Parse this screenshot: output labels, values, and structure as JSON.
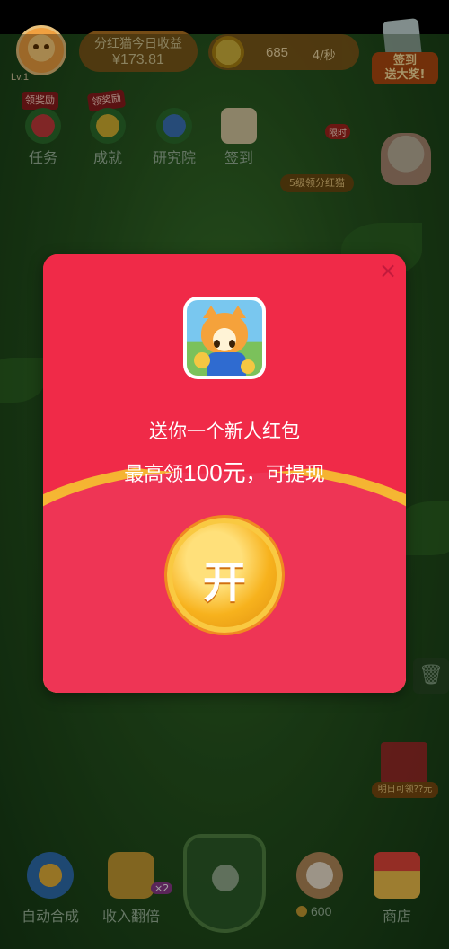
{
  "header": {
    "level": "Lv.1",
    "earnings_title": "分红猫今日收益",
    "earnings_value": "¥173.81",
    "coins": "685",
    "coin_rate": "4/秒",
    "signin_label": "签到\n送大奖!"
  },
  "quick_actions": [
    {
      "label": "任务",
      "tag": "领奖励"
    },
    {
      "label": "成就",
      "tag": "领奖励"
    },
    {
      "label": "研究院",
      "tag": ""
    },
    {
      "label": "签到",
      "tag": ""
    }
  ],
  "promo": {
    "share_label": "5级领分红猫",
    "hot_tag": "限时"
  },
  "modal": {
    "line1": "送你一个新人红包",
    "line2_prefix": "最高领",
    "line2_amount": "100元",
    "line2_suffix": "，可提现",
    "open_label": "开",
    "close_label": "×"
  },
  "side": {
    "tomorrow_label": "明日可领??元",
    "trash_label": "🗑"
  },
  "bottom_bar": {
    "auto_merge": "自动合成",
    "double_income": "收入翻倍",
    "double_badge": "×2",
    "price": "600",
    "shop": "商店"
  },
  "colors": {
    "modal_red": "#f02a48",
    "gold": "#f7b21d",
    "background_green": "#27561f"
  }
}
